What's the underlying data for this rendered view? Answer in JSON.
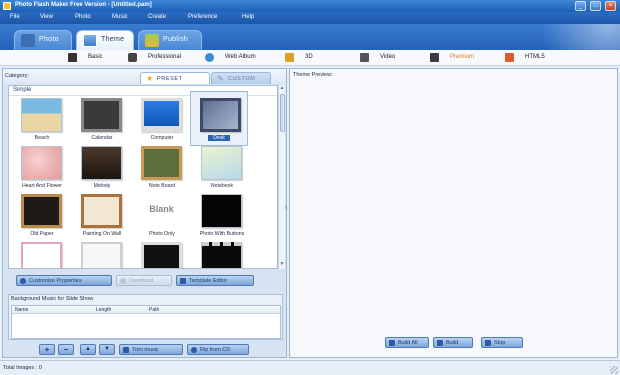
{
  "window": {
    "title": "Photo Flash Maker Free Version - [Untitled.pam]",
    "min_label": "_",
    "max_label": "□",
    "close_label": "×"
  },
  "menu": [
    "File",
    "View",
    "Photo",
    "Music",
    "Create",
    "Preference",
    "Help"
  ],
  "main_tabs": [
    {
      "label": "Photo",
      "state": "inactive",
      "icon": "camera-icon"
    },
    {
      "label": "Theme",
      "state": "active",
      "icon": "theme-icon"
    },
    {
      "label": "Publish",
      "state": "inactive",
      "icon": "publish-icon"
    }
  ],
  "categories": [
    {
      "label": "Basic",
      "icon": "film-icon"
    },
    {
      "label": "Professional",
      "icon": "camera-icon"
    },
    {
      "label": "Web Album",
      "icon": "globe-icon"
    },
    {
      "label": "3D",
      "icon": "3d-icon"
    },
    {
      "label": "Video",
      "icon": "video-icon"
    },
    {
      "label": "Premium",
      "icon": "premium-icon",
      "selected": true
    },
    {
      "label": "HTML5",
      "icon": "html5-icon"
    }
  ],
  "left": {
    "category_label": "Category:",
    "preset_tab": "Preset",
    "custom_tab": "Custom",
    "group_label": "Simple",
    "templates": [
      {
        "name": "Beach",
        "selected": false
      },
      {
        "name": "Calendar",
        "selected": false
      },
      {
        "name": "Computer",
        "selected": false
      },
      {
        "name": "Desk",
        "selected": true
      },
      {
        "name": "Heart And Flower",
        "selected": false
      },
      {
        "name": "Melody",
        "selected": false
      },
      {
        "name": "Note Board",
        "selected": false
      },
      {
        "name": "Notebook",
        "selected": false
      },
      {
        "name": "Old Paper",
        "selected": false
      },
      {
        "name": "Painting On Wall",
        "selected": false
      },
      {
        "name": "Photo Only",
        "selected": false
      },
      {
        "name": "Photo With Buttons",
        "selected": false
      }
    ],
    "blank_text": "Blank",
    "buttons": {
      "customize": "Customize Properties",
      "download": "Download",
      "template_editor": "Template Editor"
    },
    "music": {
      "title": "Background Music for Slide Show",
      "columns": [
        "Name",
        "Length",
        "Path"
      ]
    },
    "music_buttons": {
      "add": "+",
      "remove": "−",
      "up": "▲",
      "down": "▼",
      "trim": "Trim music",
      "rip": "Rip from CD"
    }
  },
  "right": {
    "preview_label": "Theme Preview:",
    "build_all": "Build All",
    "build": "Build",
    "stop": "Stop"
  },
  "status": {
    "total_images": "Total Images : 0"
  },
  "colors": {
    "titlebar": "#1d5fb7",
    "accent": "#2d62b1",
    "premium": "#e07a1a"
  }
}
